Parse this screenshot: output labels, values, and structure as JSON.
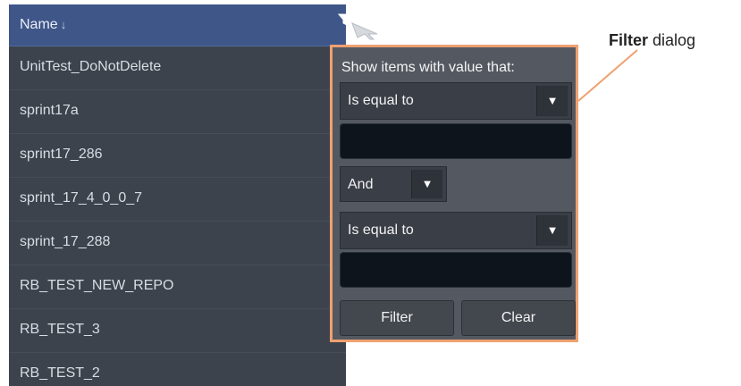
{
  "grid": {
    "column_title": "Name",
    "sort_glyph": "↓",
    "rows": [
      "UnitTest_DoNotDelete",
      "sprint17a",
      "sprint17_286",
      "sprint_17_4_0_0_7",
      "sprint_17_288",
      "RB_TEST_NEW_REPO",
      "RB_TEST_3",
      "RB_TEST_2"
    ]
  },
  "filter_dialog": {
    "label": "Show items with value that:",
    "operator1": "Is equal to",
    "value1": "",
    "logic": "And",
    "operator2": "Is equal to",
    "value2": "",
    "caret_glyph": "▼",
    "filter_button": "Filter",
    "clear_button": "Clear"
  },
  "callout": {
    "bold": "Filter",
    "rest": " dialog"
  },
  "icons": [
    "filter-icon",
    "sort-down-icon",
    "mouse-cursor-icon",
    "dropdown-caret-icon"
  ],
  "colors": {
    "header": "#3f5688",
    "grid_bg": "#3c434d",
    "dialog_bg": "#545961",
    "highlight_border": "#f0a070",
    "input_bg": "#0e141c"
  }
}
